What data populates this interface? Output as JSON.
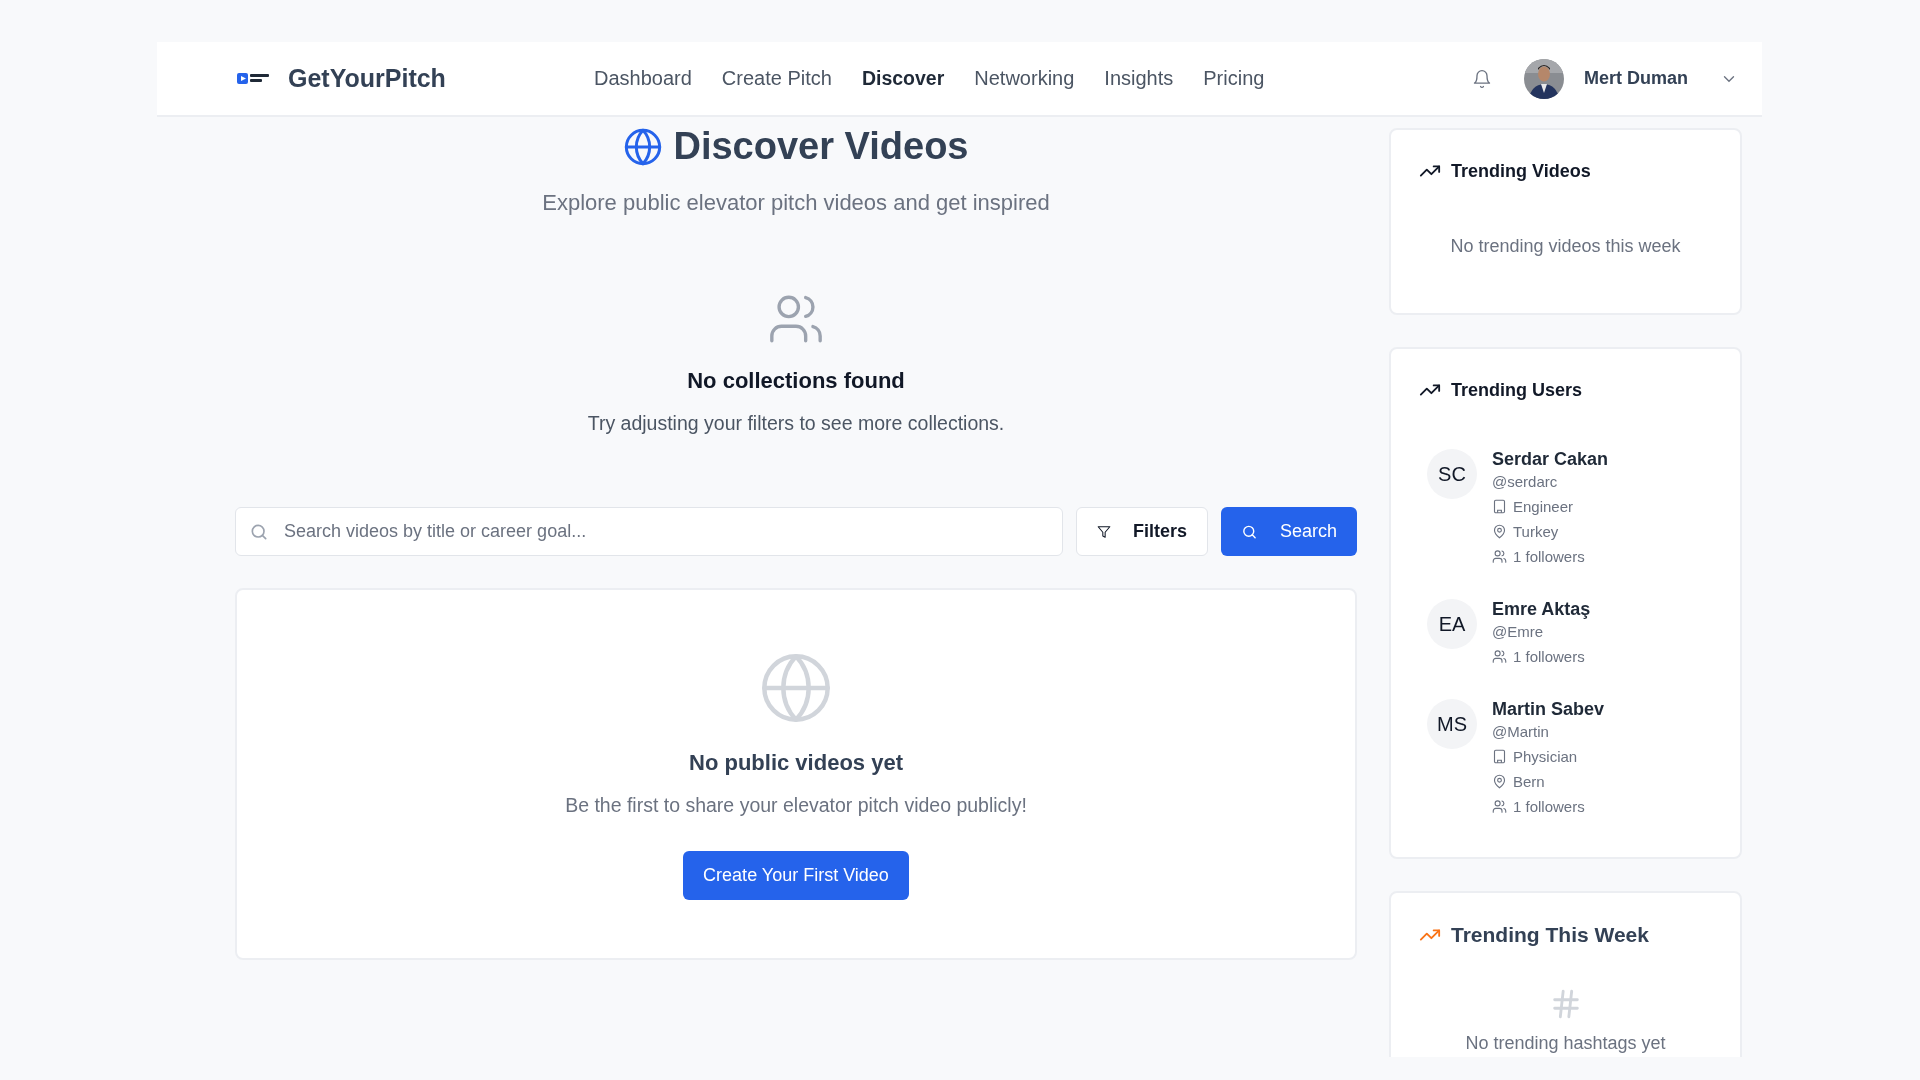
{
  "header": {
    "brand": "GetYourPitch",
    "nav": [
      {
        "label": "Dashboard",
        "selected": false
      },
      {
        "label": "Create Pitch",
        "selected": false
      },
      {
        "label": "Discover",
        "selected": true
      },
      {
        "label": "Networking",
        "selected": false
      },
      {
        "label": "Insights",
        "selected": false
      },
      {
        "label": "Pricing",
        "selected": false
      }
    ],
    "user": {
      "name": "Mert Duman"
    }
  },
  "page": {
    "title": "Discover Videos",
    "subtitle": "Explore public elevator pitch videos and get inspired"
  },
  "collections_empty": {
    "title": "No collections found",
    "text": "Try adjusting your filters to see more collections."
  },
  "search": {
    "placeholder": "Search videos by title or career goal...",
    "filters_button": "Filters",
    "search_button": "Search"
  },
  "videos_empty": {
    "title": "No public videos yet",
    "text": "Be the first to share your elevator pitch video publicly!",
    "button": "Create Your First Video"
  },
  "sidebar": {
    "trending_videos": {
      "title": "Trending Videos",
      "empty": "No trending videos this week"
    },
    "trending_users": {
      "title": "Trending Users",
      "users": [
        {
          "initials": "SC",
          "name": "Serdar Cakan",
          "handle": "@serdarc",
          "details": [
            {
              "kind": "occupation",
              "text": "Engineer"
            },
            {
              "kind": "location",
              "text": "Turkey"
            },
            {
              "kind": "followers",
              "text": "1 followers"
            }
          ]
        },
        {
          "initials": "EA",
          "name": "Emre Aktaş",
          "handle": "@Emre",
          "details": [
            {
              "kind": "followers",
              "text": "1 followers"
            }
          ]
        },
        {
          "initials": "MS",
          "name": "Martin Sabev",
          "handle": "@Martin",
          "details": [
            {
              "kind": "occupation",
              "text": "Physician"
            },
            {
              "kind": "location",
              "text": "Bern"
            },
            {
              "kind": "followers",
              "text": "1 followers"
            }
          ]
        }
      ]
    },
    "trending_week": {
      "title": "Trending This Week",
      "empty": "No trending hashtags yet"
    }
  }
}
